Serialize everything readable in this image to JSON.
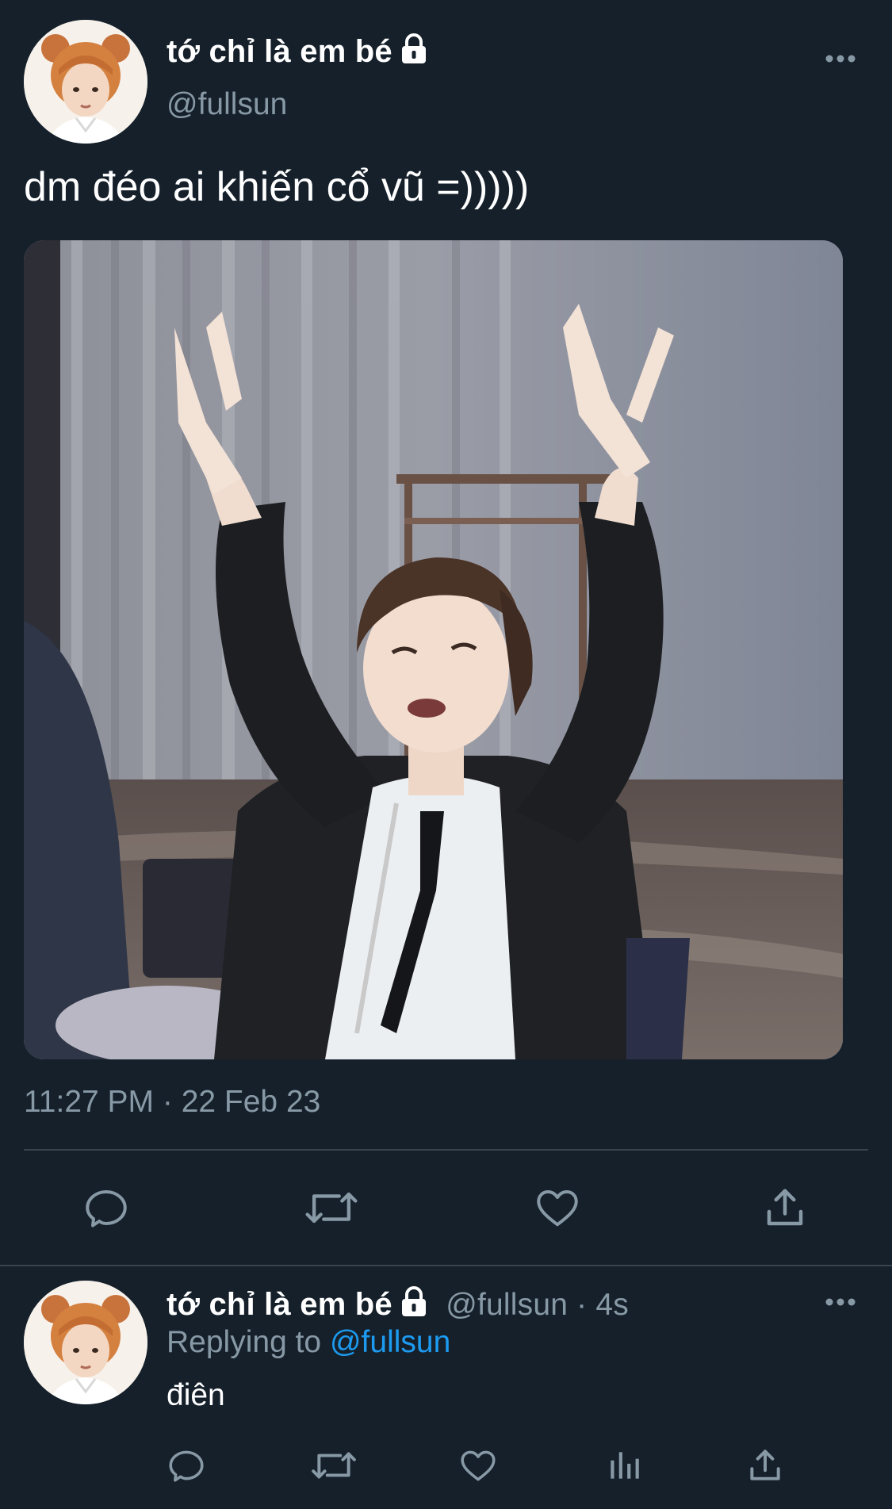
{
  "main_tweet": {
    "display_name": "tớ chỉ là em bé",
    "handle": "@fullsun",
    "text": "dm đéo ai khiến cổ vũ =)))))",
    "timestamp": "11:27 PM · 22 Feb 23"
  },
  "reply_tweet": {
    "display_name": "tớ chỉ là em bé",
    "handle_time": "@fullsun · 4s",
    "replying_prefix": "Replying to ",
    "replying_handle": "@fullsun",
    "text": "điên"
  },
  "actions": [
    "reply",
    "retweet",
    "like",
    "share"
  ],
  "reply_actions": [
    "reply",
    "retweet",
    "like",
    "analytics",
    "share"
  ],
  "colors": {
    "background": "#15202b",
    "secondary_text": "#8899a6",
    "divider": "#38444d",
    "link": "#1d9bf0"
  }
}
